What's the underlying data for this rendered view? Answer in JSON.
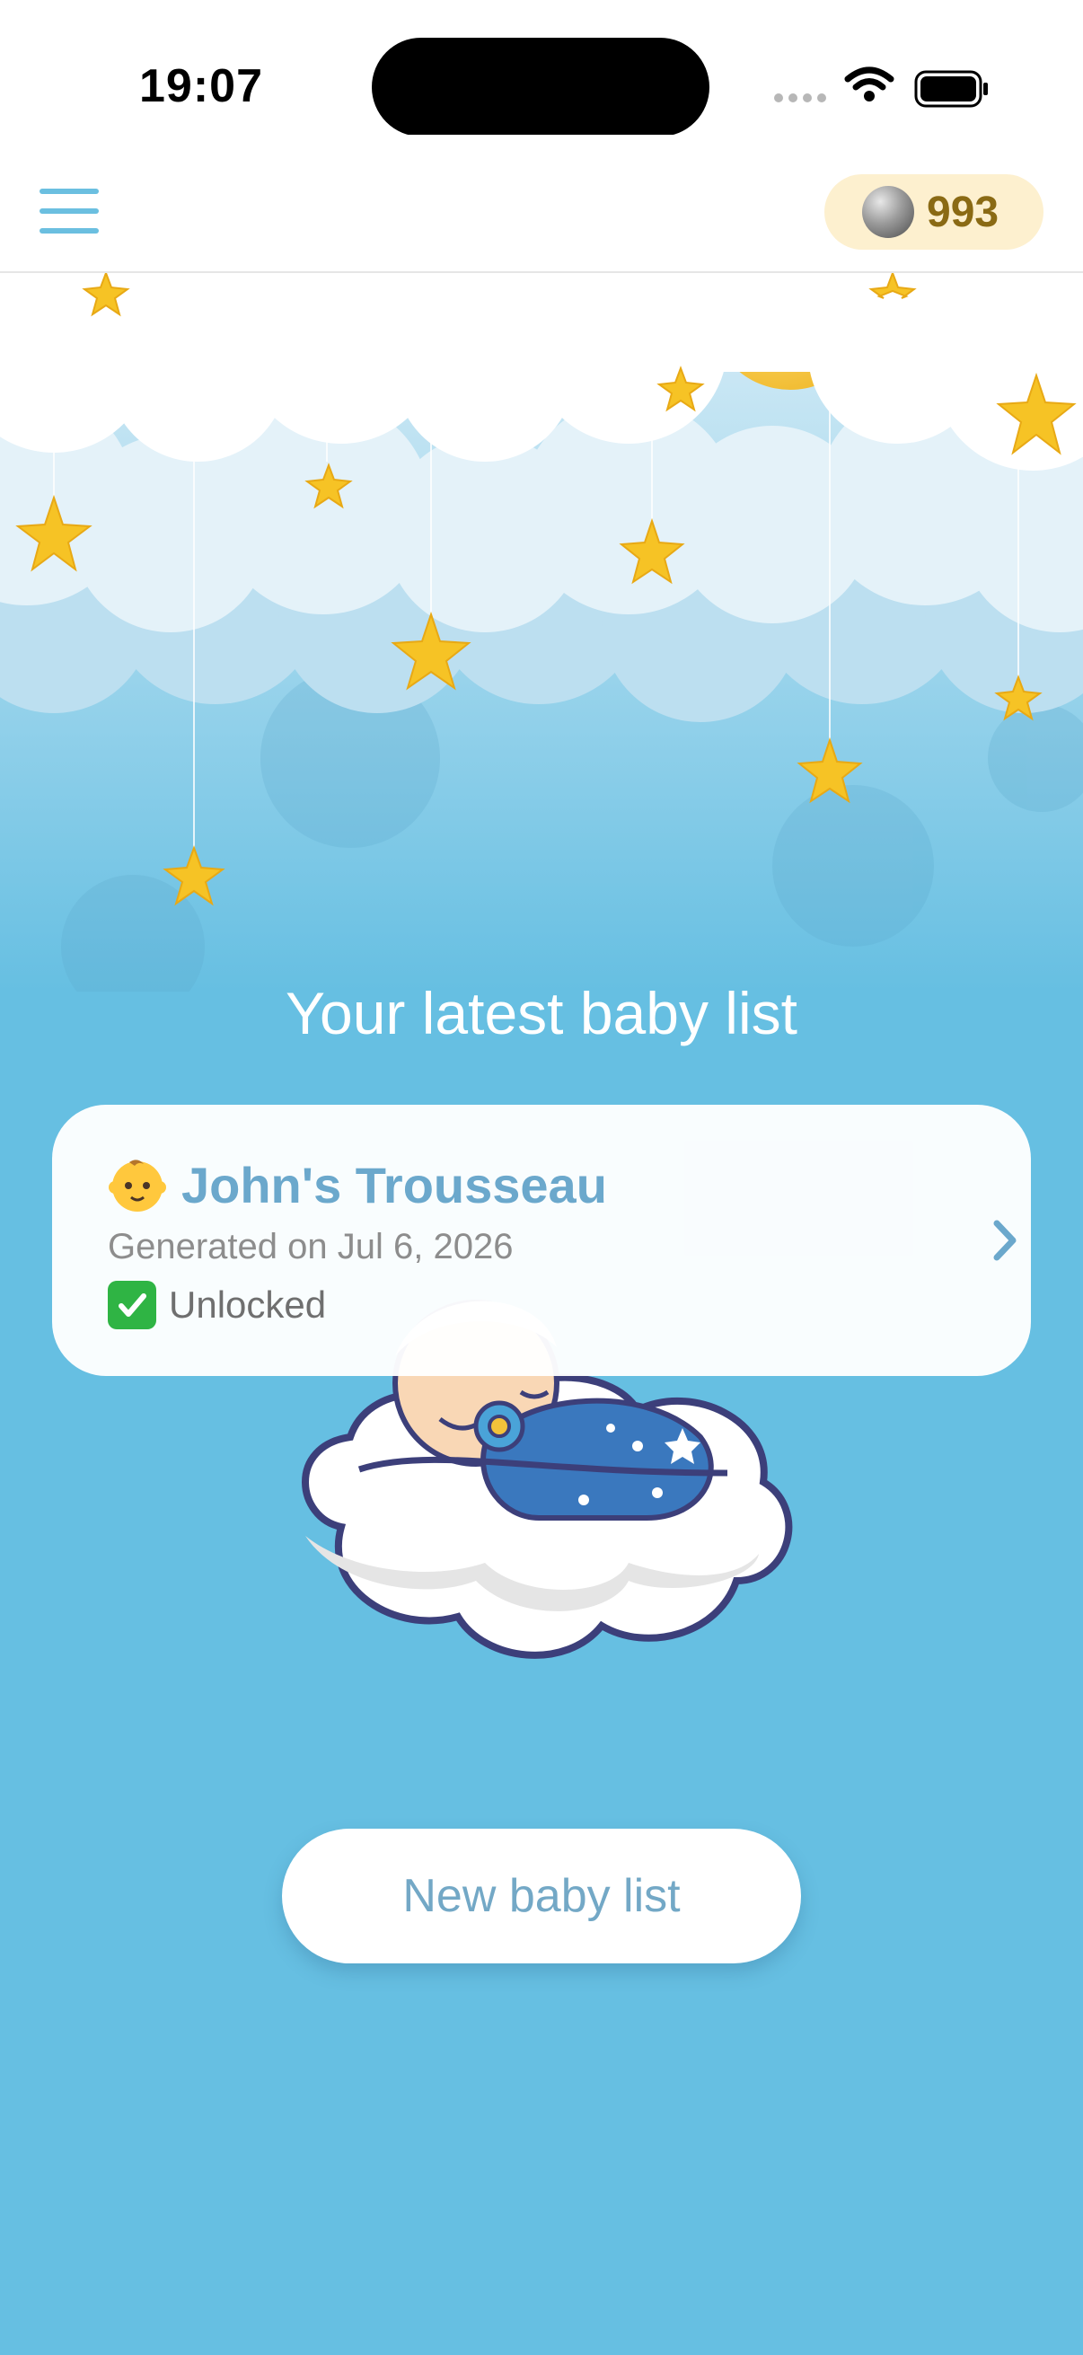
{
  "status_bar": {
    "time": "19:07"
  },
  "header": {
    "coins": "993"
  },
  "main": {
    "heading": "Your latest baby list",
    "card": {
      "title": "John's Trousseau",
      "generated": "Generated on Jul 6, 2026",
      "status": "Unlocked"
    },
    "new_button_label": "New baby list"
  },
  "icons": {
    "menu": "hamburger-icon",
    "coin": "coin-icon",
    "baby": "baby-face-icon",
    "check": "check-mark-icon",
    "chevron": "chevron-right-icon"
  },
  "colors": {
    "background": "#66bfe2",
    "accent": "#6bbfe0",
    "coin_badge_bg": "#fdf0cf",
    "coin_text": "#8a6a14",
    "card_title": "#6ba8cc",
    "check": "#2fb444"
  }
}
